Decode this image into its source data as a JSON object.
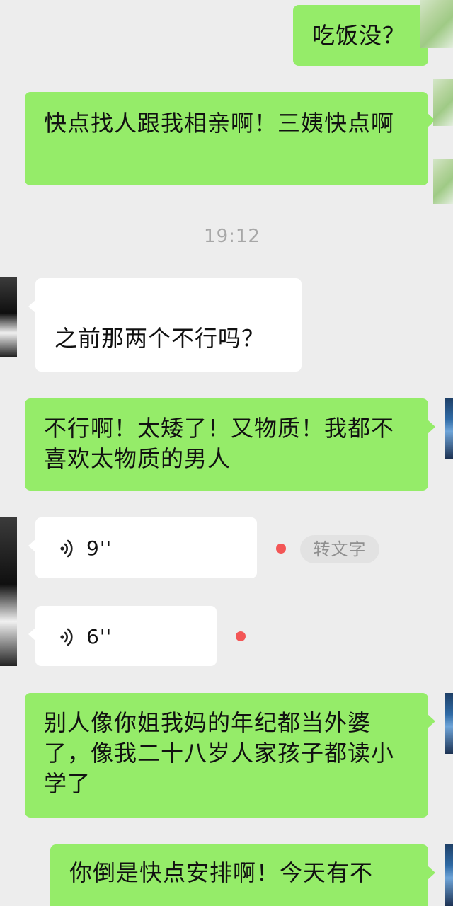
{
  "messages": [
    {
      "id": "m1",
      "text": "吃饭没？"
    },
    {
      "id": "m2",
      "text": "快点找人跟我相亲啊！三姨快点啊"
    },
    {
      "id": "m3",
      "text": "之前那两个不行吗？"
    },
    {
      "id": "m4",
      "text": "不行啊！太矮了！又物质！我都不喜欢太物质的男人"
    },
    {
      "id": "m5",
      "duration": "9''"
    },
    {
      "id": "m6",
      "duration": "6''"
    },
    {
      "id": "m7",
      "text": "别人像你姐我妈的年纪都当外婆了，像我二十八岁人家孩子都读小学了"
    },
    {
      "id": "m8",
      "text": "你倒是快点安排啊！今天有不"
    }
  ],
  "timestamp": "19:12",
  "voice_actions": {
    "transcribe_label": "转文字"
  },
  "colors": {
    "background": "#ededed",
    "outgoing_bubble": "#95ec69",
    "incoming_bubble": "#ffffff",
    "unread_dot": "#f35656",
    "timestamp_text": "#a7a7a7"
  },
  "icons": {
    "voice": "voice-wave-icon"
  }
}
